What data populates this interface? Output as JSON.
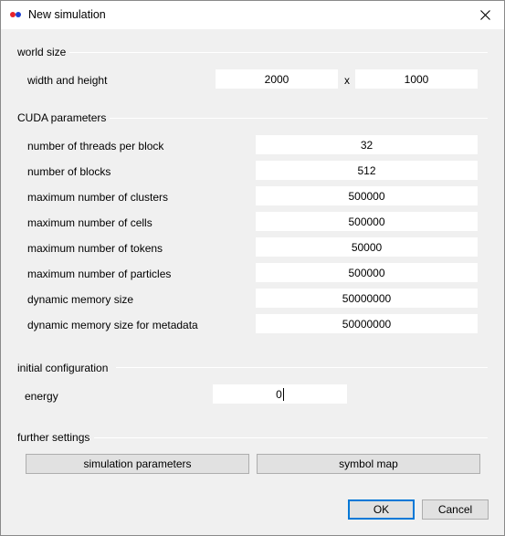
{
  "window": {
    "title": "New simulation",
    "icon": "app-icon",
    "close_icon": "close-icon"
  },
  "world_size": {
    "group_label": "world size",
    "row_label": "width and height",
    "width": "2000",
    "separator": "x",
    "height": "1000"
  },
  "cuda": {
    "group_label": "CUDA parameters",
    "rows": [
      {
        "label": "number of threads per block",
        "value": "32"
      },
      {
        "label": "number of blocks",
        "value": "512"
      },
      {
        "label": "maximum number of clusters",
        "value": "500000"
      },
      {
        "label": "maximum number of cells",
        "value": "500000"
      },
      {
        "label": "maximum number of tokens",
        "value": "50000"
      },
      {
        "label": "maximum number of particles",
        "value": "500000"
      },
      {
        "label": "dynamic memory size",
        "value": "50000000"
      },
      {
        "label": "dynamic memory size for metadata",
        "value": "50000000"
      }
    ]
  },
  "initial": {
    "group_label": "initial configuration",
    "energy_label": "energy",
    "energy_value": "0"
  },
  "further": {
    "group_label": "further settings",
    "simulation_parameters_label": "simulation parameters",
    "symbol_map_label": "symbol map"
  },
  "footer": {
    "ok_label": "OK",
    "cancel_label": "Cancel"
  }
}
